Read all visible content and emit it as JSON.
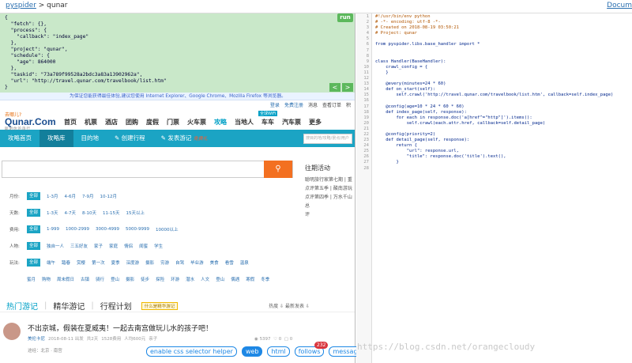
{
  "top": {
    "crumb_root": "pyspider",
    "crumb_sep": " > ",
    "project": "qunar",
    "doc": "Docum"
  },
  "task": {
    "json_lines": [
      "{",
      "  \"fetch\": {},",
      "  \"process\": {",
      "    \"callback\": \"index_page\"",
      "  },",
      "  \"project\": \"qunar\",",
      "  \"schedule\": {",
      "    \"age\": 864000",
      "  },",
      "  \"taskid\": \"73a789f99528a2bdc3a83a13902962a\",",
      "  \"url\": \"http://travel.qunar.com/travelbook/list.htm\"",
      "}"
    ],
    "run": "run",
    "prev": "<",
    "next": ">"
  },
  "site": {
    "ie_notice": "为保证您能获得最佳体验,建议您使用 Internet Explorer、Google Chrome、Mozilla Firefox 等浏览器。",
    "ubar": [
      "登录",
      "免费注册",
      "消息",
      "查看订单",
      "积"
    ],
    "logo_cn": "去哪儿?",
    "logo_en": "Qunar.Com",
    "logo_sub": "聪明你的旅行",
    "wifi": "全球WiFi",
    "mainnav": [
      "首页",
      "机票",
      "酒店",
      "团购",
      "度假",
      "门票",
      "火车票",
      "攻略",
      "当地人",
      "车车",
      "汽车票",
      "更多"
    ],
    "bluebar": [
      "攻略首页",
      "攻略库",
      "目的地",
      "创建行程",
      "发表游记"
    ],
    "hot": "免费礼",
    "bluebar_search": "搜目的地/攻略/景点/用户",
    "right_title": "往期活动",
    "right_items": [
      "聪明旅行家第七期 | 重",
      "点评第五季 | 酸南游玩",
      "点评第四季 | 万水千山总",
      "评"
    ],
    "filters": [
      {
        "label": "月份:",
        "all": "全部",
        "opts": [
          "1-3月",
          "4-6月",
          "7-9月",
          "10-12月"
        ]
      },
      {
        "label": "天数:",
        "all": "全部",
        "opts": [
          "1-3天",
          "4-7天",
          "8-10天",
          "11-15天",
          "15天以上"
        ]
      },
      {
        "label": "费用:",
        "all": "全部",
        "opts": [
          "1-999",
          "1000-2999",
          "3000-4999",
          "5000-9999",
          "10000以上"
        ]
      },
      {
        "label": "人物:",
        "all": "全部",
        "opts": [
          "独自一人",
          "三五好友",
          "家子",
          "家庭",
          "情侣",
          "闺蜜",
          "学生"
        ]
      },
      {
        "label": "玩法:",
        "all": "全部",
        "opts": [
          "端午",
          "踏春",
          "赏樱",
          "第一次",
          "夏季",
          "深度游",
          "摄影",
          "穷游",
          "自驾",
          "毕业游",
          "美食",
          "看雪",
          "温泉"
        ]
      },
      {
        "label": "",
        "all": "",
        "opts": [
          "蜜月",
          "购物",
          "周末假日",
          "古镇",
          "骑行",
          "登山",
          "摄影",
          "徒步",
          "探险",
          "环游",
          "潜水",
          "人文",
          "登山",
          "偶遇",
          "寒假",
          "冬季"
        ]
      }
    ],
    "tabs2": [
      "热门游记",
      "精华游记",
      "行程计划"
    ],
    "pill": "什么是精华游记",
    "sort": "热度 ⇩   最新发表 ⇩",
    "article": {
      "title": "不出京城，假装在夏威夷！一起去南宫做玩儿水的孩子吧！",
      "user": "美伦卡尼",
      "meta": [
        "2018-08-11 出发",
        "共2天",
        "1528费用",
        "人均600元",
        "亲子"
      ],
      "views": "5397",
      "likes": "0",
      "comments": "0",
      "route": "途经：北京 · 南宫"
    }
  },
  "helper": {
    "css": "enable css selector helper",
    "web": "web",
    "html": "html",
    "follows": "follows",
    "follows_count": "232",
    "messages": "messages"
  },
  "code": [
    "#!/usr/bin/env python",
    "# -*- encoding: utf-8 -*-",
    "# Created on 2018-08-19 03:50:21",
    "# Project: qunar",
    "",
    "from pyspider.libs.base_handler import *",
    "",
    "",
    "class Handler(BaseHandler):",
    "    crawl_config = {",
    "    }",
    "",
    "    @every(minutes=24 * 60)",
    "    def on_start(self):",
    "        self.crawl('http://travel.qunar.com/travelbook/list.htm', callback=self.index_page)",
    "",
    "    @config(age=10 * 24 * 60 * 60)",
    "    def index_page(self, response):",
    "        for each in response.doc('a[href^=\"http\"]').items():",
    "            self.crawl(each.attr.href, callback=self.detail_page)",
    "",
    "    @config(priority=2)",
    "    def detail_page(self, response):",
    "        return {",
    "            \"url\": response.url,",
    "            \"title\": response.doc('title').text(),",
    "        }",
    ""
  ],
  "watermark": "https://blog.csdn.net/orangecloudy"
}
